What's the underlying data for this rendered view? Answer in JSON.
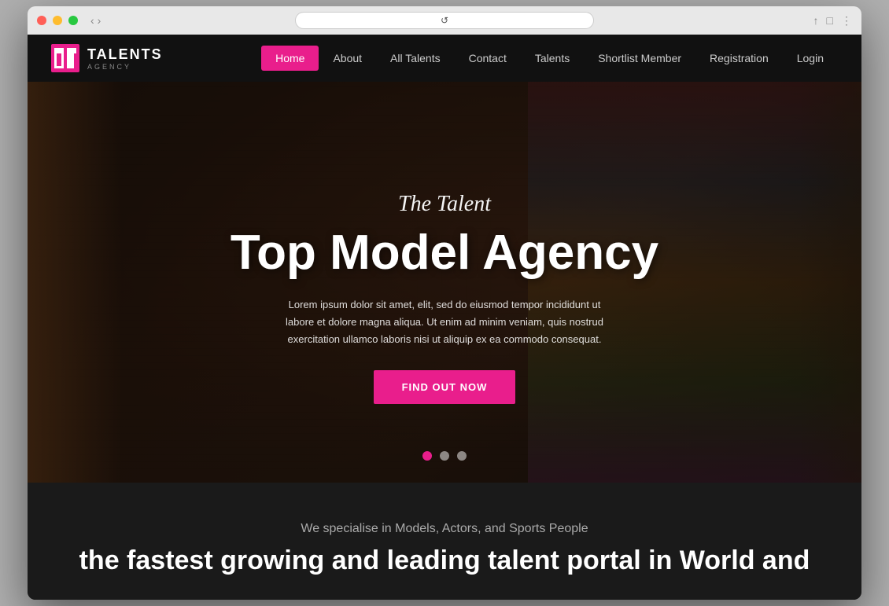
{
  "window": {
    "url": ""
  },
  "navbar": {
    "logo_title": "TALENTS",
    "logo_subtitle": "AGENCY",
    "nav_items": [
      {
        "label": "Home",
        "active": true
      },
      {
        "label": "About",
        "active": false
      },
      {
        "label": "All Talents",
        "active": false
      },
      {
        "label": "Contact",
        "active": false
      },
      {
        "label": "Talents",
        "active": false
      },
      {
        "label": "Shortlist Member",
        "active": false
      },
      {
        "label": "Registration",
        "active": false
      },
      {
        "label": "Login",
        "active": false
      }
    ]
  },
  "hero": {
    "subtitle": "The Talent",
    "title": "Top Model Agency",
    "description": "Lorem ipsum dolor sit amet, elit, sed do eiusmod tempor incididunt ut labore et dolore magna aliqua. Ut enim ad minim veniam, quis nostrud exercitation ullamco laboris nisi ut aliquip ex ea commodo consequat.",
    "cta_button": "FIND OUT NOW",
    "dots": [
      {
        "active": true
      },
      {
        "active": false
      },
      {
        "active": false
      }
    ]
  },
  "below_fold": {
    "subtitle": "We specialise in Models, Actors, and Sports People",
    "title": "the fastest growing and leading talent portal in World and"
  },
  "colors": {
    "brand_pink": "#e91e8c",
    "nav_bg": "#111111",
    "hero_bg": "#1c110a",
    "site_bg": "#1a1a1a",
    "text_white": "#ffffff",
    "text_gray": "#aaaaaa"
  }
}
